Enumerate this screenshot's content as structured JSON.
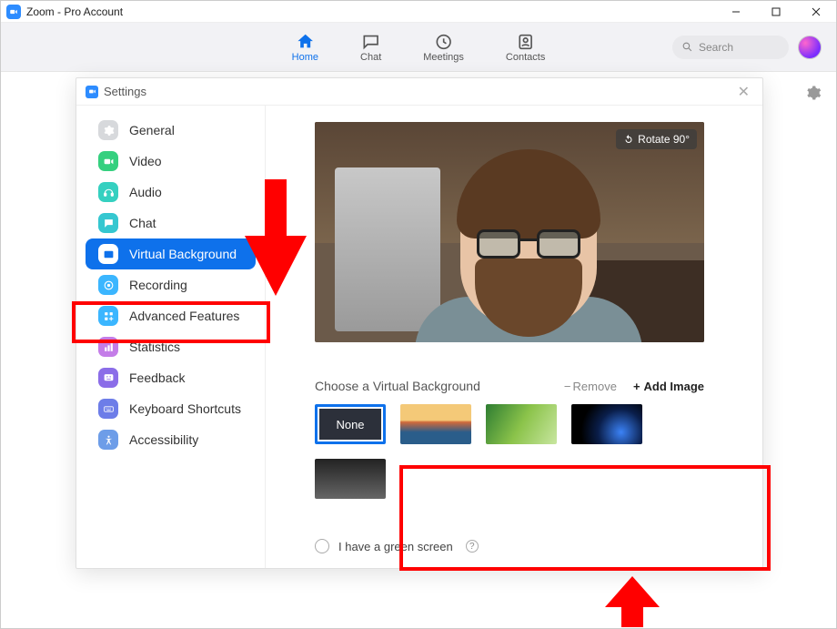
{
  "window": {
    "title": "Zoom - Pro Account"
  },
  "tabs": {
    "home": "Home",
    "chat": "Chat",
    "meetings": "Meetings",
    "contacts": "Contacts"
  },
  "search": {
    "placeholder": "Search"
  },
  "settings": {
    "title": "Settings",
    "items": [
      {
        "label": "General",
        "icon_bg": "#d7d9dc",
        "icon_fg": "#fff"
      },
      {
        "label": "Video",
        "icon_bg": "#35d07f",
        "icon_fg": "#fff"
      },
      {
        "label": "Audio",
        "icon_bg": "#35d0c0",
        "icon_fg": "#fff"
      },
      {
        "label": "Chat",
        "icon_bg": "#35c7d0",
        "icon_fg": "#fff"
      },
      {
        "label": "Virtual Background",
        "icon_bg": "#0E71EB",
        "icon_fg": "#fff",
        "active": true
      },
      {
        "label": "Recording",
        "icon_bg": "#3bb6ff",
        "icon_fg": "#fff"
      },
      {
        "label": "Advanced Features",
        "icon_bg": "#3bb6ff",
        "icon_fg": "#fff"
      },
      {
        "label": "Statistics",
        "icon_bg": "#c47de8",
        "icon_fg": "#fff"
      },
      {
        "label": "Feedback",
        "icon_bg": "#8b6de8",
        "icon_fg": "#fff"
      },
      {
        "label": "Keyboard Shortcuts",
        "icon_bg": "#6d7de8",
        "icon_fg": "#fff"
      },
      {
        "label": "Accessibility",
        "icon_bg": "#6d9de8",
        "icon_fg": "#fff"
      }
    ]
  },
  "preview": {
    "rotate_label": "Rotate 90°"
  },
  "vbgsection": {
    "choose_label": "Choose a Virtual Background",
    "remove_label": "Remove",
    "add_label": "Add Image",
    "none_label": "None",
    "thumbs": [
      "none",
      "bridge",
      "grass",
      "earth",
      "clouds"
    ]
  },
  "greenscreen": {
    "label": "I have a green screen"
  }
}
